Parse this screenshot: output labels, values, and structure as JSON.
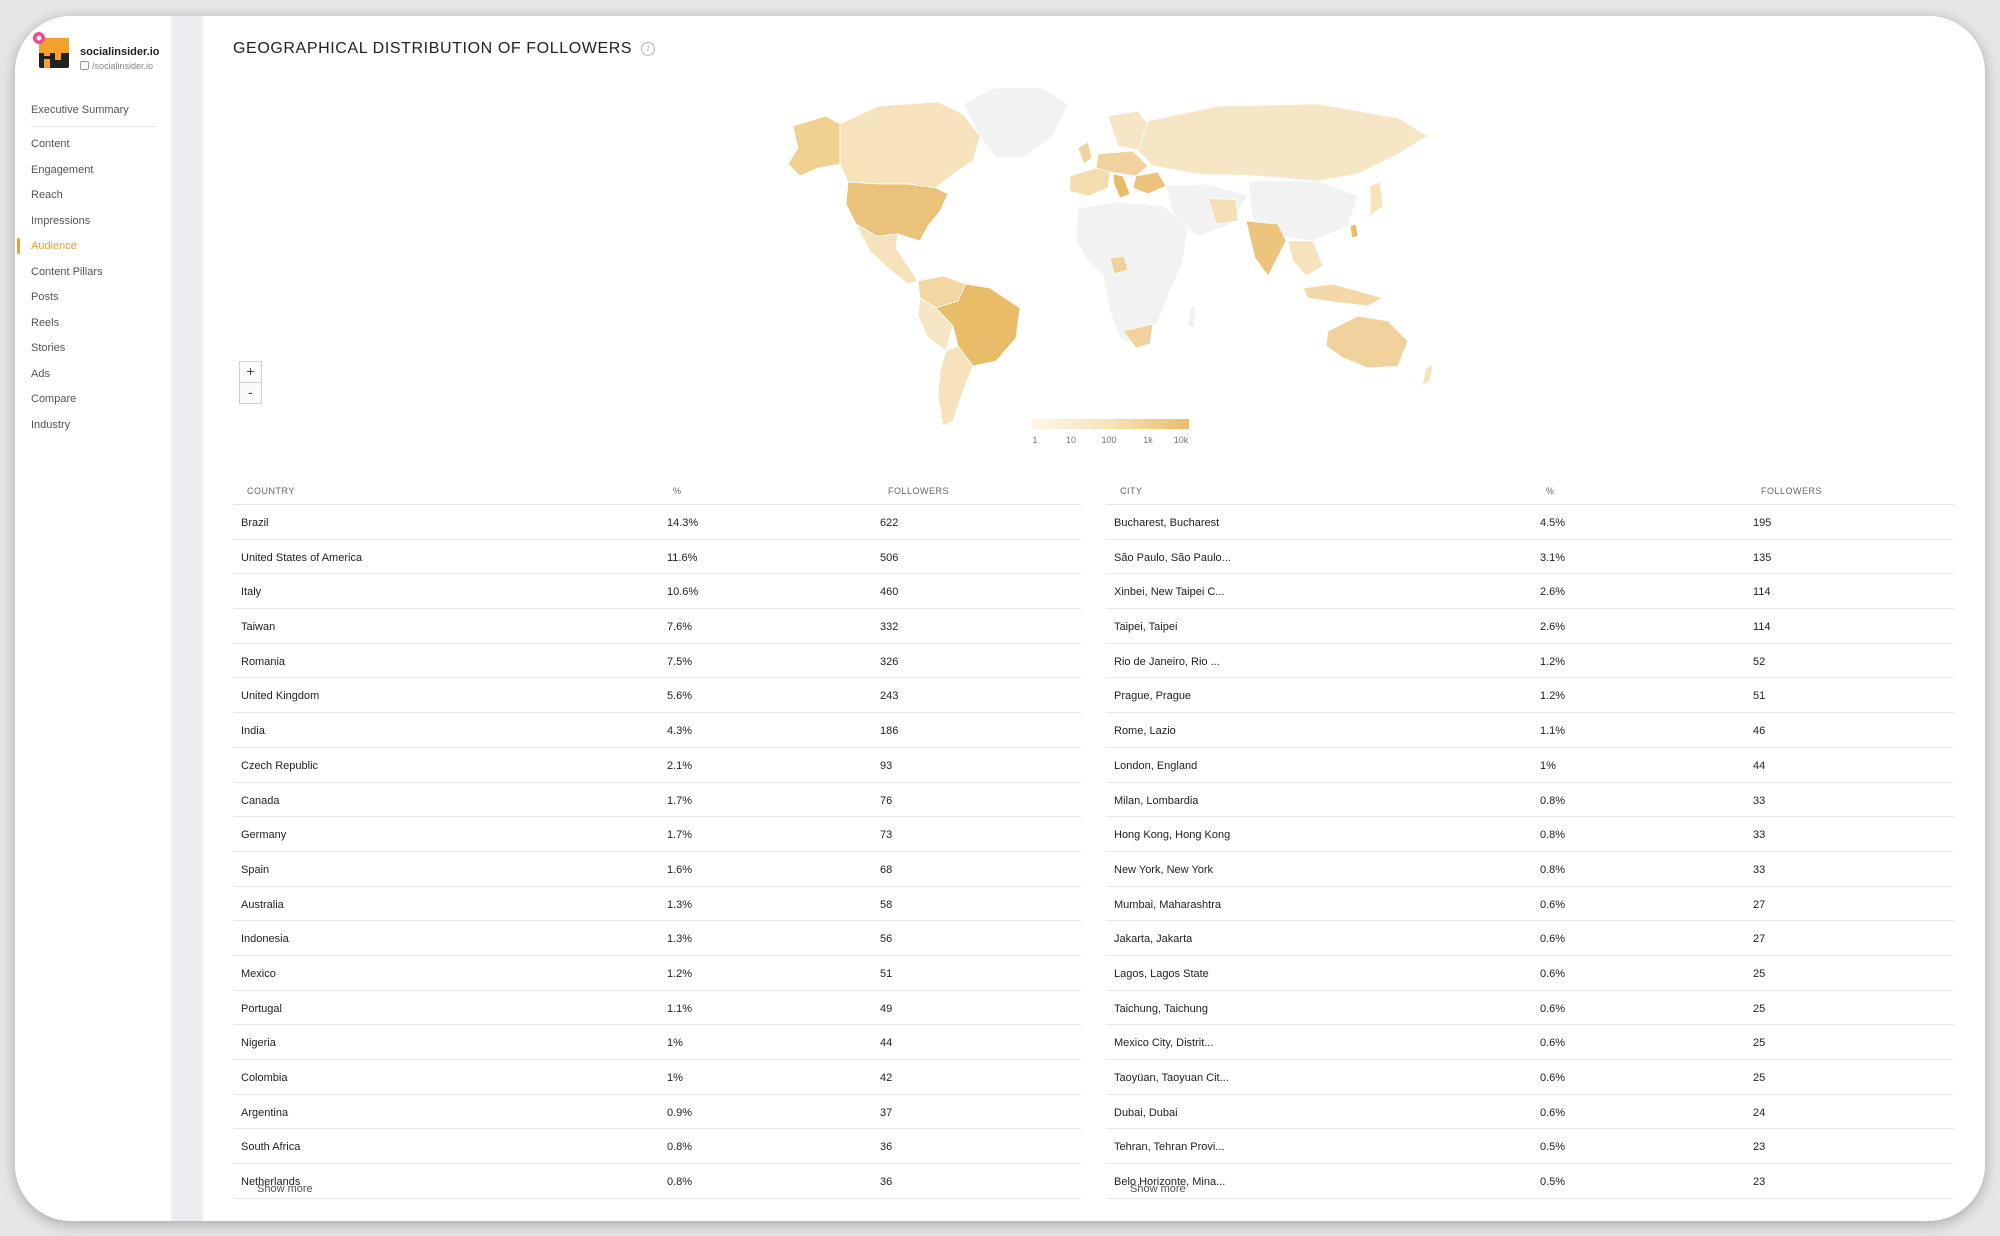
{
  "sidebar": {
    "brand_name": "socialinsider.io",
    "brand_handle": "/socialinsider.io",
    "items": [
      {
        "label": "Executive Summary",
        "active": false
      },
      {
        "label": "Content",
        "active": false
      },
      {
        "label": "Engagement",
        "active": false
      },
      {
        "label": "Reach",
        "active": false
      },
      {
        "label": "Impressions",
        "active": false
      },
      {
        "label": "Audience",
        "active": true
      },
      {
        "label": "Content Pillars",
        "active": false
      },
      {
        "label": "Posts",
        "active": false
      },
      {
        "label": "Reels",
        "active": false
      },
      {
        "label": "Stories",
        "active": false
      },
      {
        "label": "Ads",
        "active": false
      },
      {
        "label": "Compare",
        "active": false
      },
      {
        "label": "Industry",
        "active": false
      }
    ]
  },
  "main": {
    "title": "GEOGRAPHICAL DISTRIBUTION OF FOLLOWERS",
    "info_icon": "i",
    "zoom_in": "+",
    "zoom_out": "-",
    "legend": {
      "colors": [
        "#fdf6e6",
        "#f6e3bb",
        "#e9bd68"
      ],
      "labels": [
        "1",
        "10",
        "100",
        "1k",
        "10k"
      ]
    }
  },
  "colors": {
    "accent": "#e8a03a",
    "map_none": "#f2f2f2",
    "map_low": "#f7e6c5",
    "map_mid": "#f1d29c",
    "map_high": "#e9bf72"
  },
  "country_table": {
    "headers": [
      "COUNTRY",
      "%",
      "FOLLOWERS"
    ],
    "rows": [
      [
        "Brazil",
        "14.3%",
        "622"
      ],
      [
        "United States of America",
        "11.6%",
        "506"
      ],
      [
        "Italy",
        "10.6%",
        "460"
      ],
      [
        "Taiwan",
        "7.6%",
        "332"
      ],
      [
        "Romania",
        "7.5%",
        "326"
      ],
      [
        "United Kingdom",
        "5.6%",
        "243"
      ],
      [
        "India",
        "4.3%",
        "186"
      ],
      [
        "Czech Republic",
        "2.1%",
        "93"
      ],
      [
        "Canada",
        "1.7%",
        "76"
      ],
      [
        "Germany",
        "1.7%",
        "73"
      ],
      [
        "Spain",
        "1.6%",
        "68"
      ],
      [
        "Australia",
        "1.3%",
        "58"
      ],
      [
        "Indonesia",
        "1.3%",
        "56"
      ],
      [
        "Mexico",
        "1.2%",
        "51"
      ],
      [
        "Portugal",
        "1.1%",
        "49"
      ],
      [
        "Nigeria",
        "1%",
        "44"
      ],
      [
        "Colombia",
        "1%",
        "42"
      ],
      [
        "Argentina",
        "0.9%",
        "37"
      ],
      [
        "South Africa",
        "0.8%",
        "36"
      ],
      [
        "Netherlands",
        "0.8%",
        "36"
      ]
    ],
    "show_more": "Show more"
  },
  "city_table": {
    "headers": [
      "CITY",
      "%",
      "FOLLOWERS"
    ],
    "rows": [
      [
        "Bucharest, Bucharest",
        "4.5%",
        "195"
      ],
      [
        "São Paulo, São Paulo...",
        "3.1%",
        "135"
      ],
      [
        "Xinbei, New Taipei C...",
        "2.6%",
        "114"
      ],
      [
        "Taipei, Taipei",
        "2.6%",
        "114"
      ],
      [
        "Rio de Janeiro, Rio ...",
        "1.2%",
        "52"
      ],
      [
        "Prague, Prague",
        "1.2%",
        "51"
      ],
      [
        "Rome, Lazio",
        "1.1%",
        "46"
      ],
      [
        "London, England",
        "1%",
        "44"
      ],
      [
        "Milan, Lombardia",
        "0.8%",
        "33"
      ],
      [
        "Hong Kong, Hong Kong",
        "0.8%",
        "33"
      ],
      [
        "New York, New York",
        "0.8%",
        "33"
      ],
      [
        "Mumbai, Maharashtra",
        "0.6%",
        "27"
      ],
      [
        "Jakarta, Jakarta",
        "0.6%",
        "27"
      ],
      [
        "Lagos, Lagos State",
        "0.6%",
        "25"
      ],
      [
        "Taichung, Taichung",
        "0.6%",
        "25"
      ],
      [
        "Mexico City, Distrit...",
        "0.6%",
        "25"
      ],
      [
        "Taoyüan, Taoyuan Cit...",
        "0.6%",
        "25"
      ],
      [
        "Dubai, Dubai",
        "0.6%",
        "24"
      ],
      [
        "Tehran, Tehran Provi...",
        "0.5%",
        "23"
      ],
      [
        "Belo Horizonte, Mina...",
        "0.5%",
        "23"
      ]
    ],
    "show_more": "Show more"
  }
}
